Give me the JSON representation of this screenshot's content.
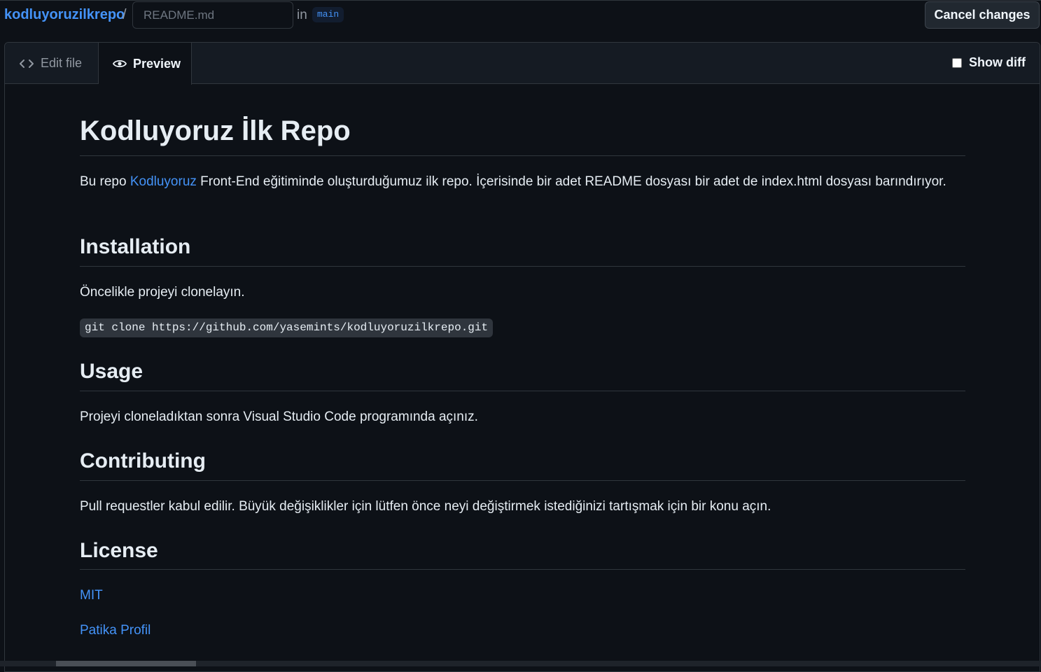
{
  "header": {
    "repo_name": "kodluyoruzilkrepo",
    "separator": "/",
    "filename_placeholder": "README.md",
    "in_label": "in",
    "branch": "main",
    "cancel_label": "Cancel changes"
  },
  "tabs": {
    "edit_label": "Edit file",
    "preview_label": "Preview",
    "active": "Preview"
  },
  "show_diff": {
    "label": "Show diff",
    "checked": false
  },
  "preview": {
    "title": "Kodluyoruz İlk Repo",
    "intro_prefix": "Bu repo ",
    "intro_link": "Kodluyoruz",
    "intro_suffix": " Front-End eğitiminde oluşturduğumuz ilk repo. İçerisinde bir adet README dosyası bir adet de index.html dosyası barındırıyor.",
    "installation_heading": "Installation",
    "installation_text": "Öncelikle projeyi clonelayın.",
    "installation_code": "git clone https://github.com/yasemints/kodluyoruzilkrepo.git",
    "usage_heading": "Usage",
    "usage_text": "Projeyi cloneladıktan sonra Visual Studio Code programında açınız.",
    "contributing_heading": "Contributing",
    "contributing_text": "Pull requestler kabul edilir. Büyük değişiklikler için lütfen önce neyi değiştirmek istediğinizi tartışmak için bir konu açın.",
    "license_heading": "License",
    "license_link": "MIT",
    "profile_link": "Patika Profil"
  },
  "colors": {
    "background": "#0d1117",
    "link": "#4493f8",
    "border": "#30363d",
    "text": "#e6edf3"
  }
}
